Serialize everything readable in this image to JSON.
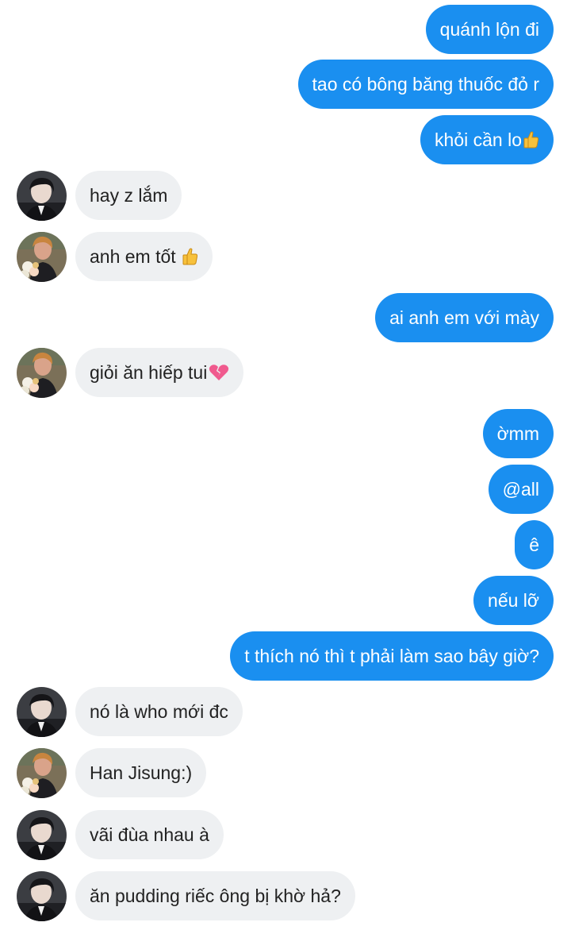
{
  "messages": [
    {
      "text": "quánh lộn đi"
    },
    {
      "text": "tao có bông băng thuốc đỏ r"
    },
    {
      "text": "khỏi cần lo"
    },
    {
      "text": "hay z lắm"
    },
    {
      "text": "anh em tốt"
    },
    {
      "text": "ai anh em với mày"
    },
    {
      "text": "giỏi ăn hiếp tui"
    },
    {
      "text": "ờmm"
    },
    {
      "text": "@all"
    },
    {
      "text": "ê"
    },
    {
      "text": "nếu lỡ"
    },
    {
      "text": "t thích nó thì t phải làm sao bây giờ?"
    },
    {
      "text": "nó là who mới đc"
    },
    {
      "text": "Han Jisung:)"
    },
    {
      "text": "vãi đùa nhau à"
    },
    {
      "text": "ăn pudding riếc ông bị khờ hả?"
    }
  ],
  "colors": {
    "outgoing_bubble": "#1a8ff0",
    "incoming_bubble": "#eef0f2",
    "outgoing_text": "#ffffff",
    "incoming_text": "#222222"
  },
  "icons": {
    "thumbs_up": "thumbs-up-icon",
    "broken_heart": "broken-heart-icon"
  }
}
